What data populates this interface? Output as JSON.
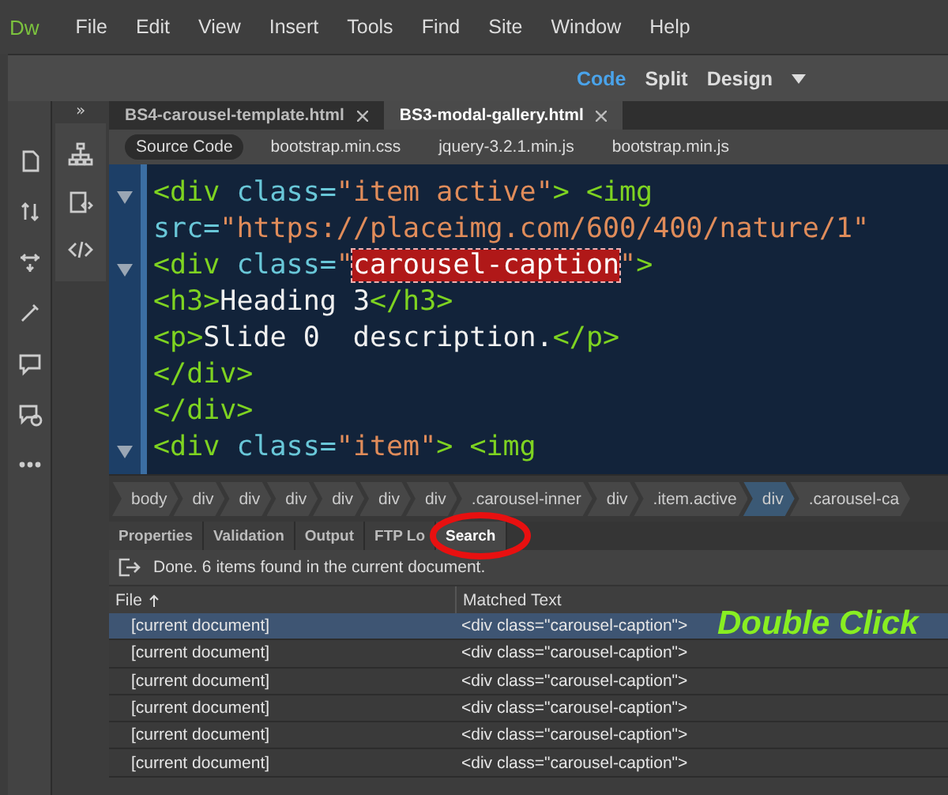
{
  "app": {
    "logo": "Dw"
  },
  "menu": [
    "File",
    "Edit",
    "View",
    "Insert",
    "Tools",
    "Find",
    "Site",
    "Window",
    "Help"
  ],
  "views": [
    {
      "label": "Code",
      "selected": true
    },
    {
      "label": "Split",
      "selected": false
    },
    {
      "label": "Design",
      "selected": false
    }
  ],
  "collapse": "»",
  "doc_tabs": [
    {
      "label": "BS4-carousel-template.html",
      "selected": false
    },
    {
      "label": "BS3-modal-gallery.html",
      "selected": true
    }
  ],
  "related_files": [
    {
      "label": "Source Code",
      "selected": true
    },
    {
      "label": "bootstrap.min.css",
      "selected": false
    },
    {
      "label": "jquery-3.2.1.min.js",
      "selected": false
    },
    {
      "label": "bootstrap.min.js",
      "selected": false
    }
  ],
  "code_lines": [
    {
      "fold": true,
      "tokens": [
        {
          "kind": "tag",
          "text": "<div "
        },
        {
          "kind": "attr",
          "text": "class="
        },
        {
          "kind": "string",
          "text": "\"item active\""
        },
        {
          "kind": "tag",
          "text": "> <img"
        }
      ]
    },
    {
      "fold": false,
      "tokens": [
        {
          "kind": "attr",
          "text": "src="
        },
        {
          "kind": "string",
          "text": "\"https://placeimg.com/600/400/nature/1\""
        }
      ]
    },
    {
      "fold": true,
      "tokens": [
        {
          "kind": "tag",
          "text": "<div "
        },
        {
          "kind": "attr",
          "text": "class="
        },
        {
          "kind": "string",
          "text": "\""
        },
        {
          "kind": "match",
          "text": "carousel-caption"
        },
        {
          "kind": "string",
          "text": "\""
        },
        {
          "kind": "tag",
          "text": ">"
        }
      ]
    },
    {
      "fold": false,
      "tokens": [
        {
          "kind": "tag",
          "text": "<h3>"
        },
        {
          "kind": "text",
          "text": "Heading 3"
        },
        {
          "kind": "tag",
          "text": "</h3>"
        }
      ]
    },
    {
      "fold": false,
      "tokens": [
        {
          "kind": "tag",
          "text": "<p>"
        },
        {
          "kind": "text",
          "text": "Slide 0  description."
        },
        {
          "kind": "tag",
          "text": "</p>"
        }
      ]
    },
    {
      "fold": false,
      "tokens": [
        {
          "kind": "tag",
          "text": "</div>"
        }
      ]
    },
    {
      "fold": false,
      "tokens": [
        {
          "kind": "tag",
          "text": "</div>"
        }
      ]
    },
    {
      "fold": true,
      "tokens": [
        {
          "kind": "tag",
          "text": "<div "
        },
        {
          "kind": "attr",
          "text": "class="
        },
        {
          "kind": "string",
          "text": "\"item\""
        },
        {
          "kind": "tag",
          "text": "> <img"
        }
      ]
    }
  ],
  "breadcrumbs": [
    {
      "label": "body",
      "selected": false
    },
    {
      "label": "div",
      "selected": false
    },
    {
      "label": "div",
      "selected": false
    },
    {
      "label": "div",
      "selected": false
    },
    {
      "label": "div",
      "selected": false
    },
    {
      "label": "div",
      "selected": false
    },
    {
      "label": "div",
      "selected": false
    },
    {
      "label": ".carousel-inner",
      "selected": false
    },
    {
      "label": "div",
      "selected": false
    },
    {
      "label": ".item.active",
      "selected": false
    },
    {
      "label": "div",
      "selected": true
    },
    {
      "label": ".carousel-ca",
      "selected": false
    }
  ],
  "panel_tabs": [
    {
      "label": "Properties",
      "selected": false
    },
    {
      "label": "Validation",
      "selected": false
    },
    {
      "label": "Output",
      "selected": false
    },
    {
      "label": "FTP Lo",
      "selected": false
    },
    {
      "label": "Search",
      "selected": true
    }
  ],
  "search_status": "Done. 6 items found in the current document.",
  "results": {
    "columns": [
      {
        "label": "File",
        "sorted": true
      },
      {
        "label": "Matched Text",
        "sorted": false
      }
    ],
    "rows": [
      {
        "file": "[current document]",
        "match": "<div class=\"carousel-caption\">",
        "selected": true
      },
      {
        "file": "[current document]",
        "match": "<div class=\"carousel-caption\">",
        "selected": false
      },
      {
        "file": "[current document]",
        "match": "<div class=\"carousel-caption\">",
        "selected": false
      },
      {
        "file": "[current document]",
        "match": "<div class=\"carousel-caption\">",
        "selected": false
      },
      {
        "file": "[current document]",
        "match": "<div class=\"carousel-caption\">",
        "selected": false
      },
      {
        "file": "[current document]",
        "match": "<div class=\"carousel-caption\">",
        "selected": false
      }
    ]
  },
  "annotation": "Double Click"
}
